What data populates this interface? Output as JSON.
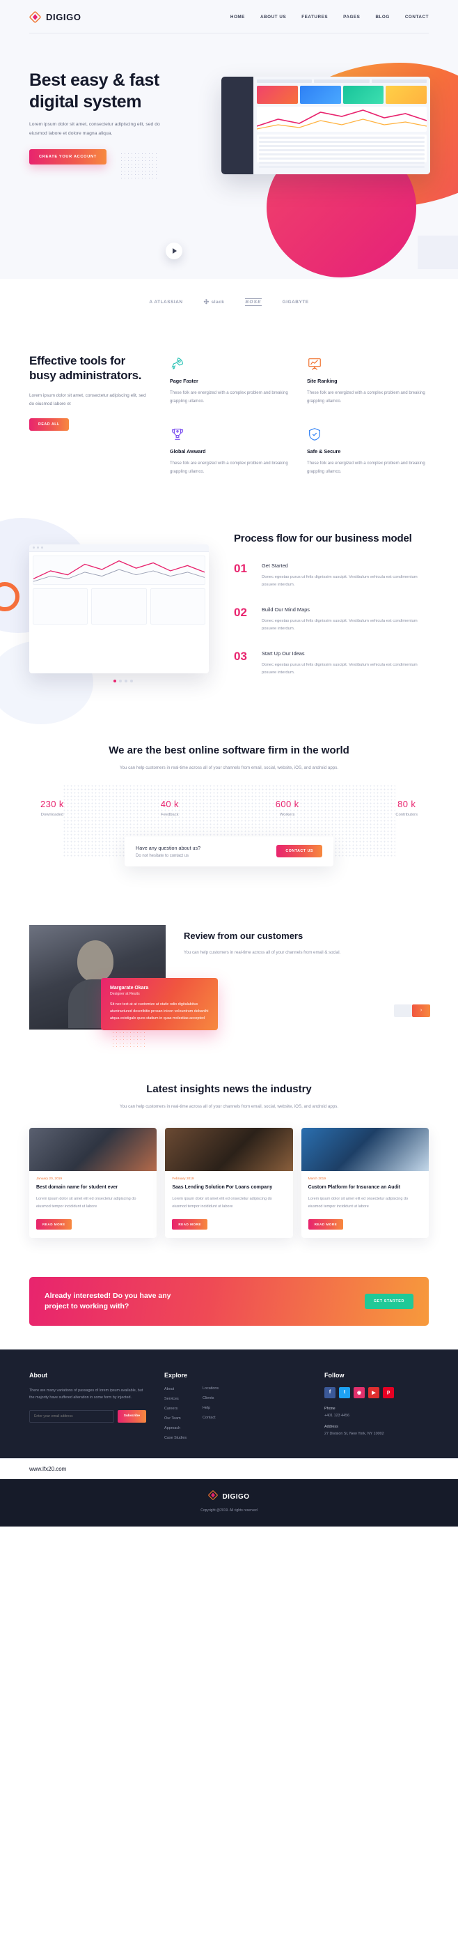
{
  "header": {
    "brand": "DIGIGO",
    "logo_icon": "diamond-logo-icon",
    "nav": [
      {
        "label": "HOME"
      },
      {
        "label": "ABOUT US"
      },
      {
        "label": "FEATURES"
      },
      {
        "label": "PAGES"
      },
      {
        "label": "BLOG"
      },
      {
        "label": "CONTACT"
      }
    ]
  },
  "hero": {
    "title": "Best easy & fast digital system",
    "subtitle": "Lorem ipsum dolor sit amet, consectetur adipiscing elit, sed do eiusmod labore et dolore magna aliqua.",
    "cta_label": "CREATE YOUR ACCOUNT",
    "play_icon": "play-icon"
  },
  "logos": [
    {
      "name": "A ATLASSIAN"
    },
    {
      "name": "slack"
    },
    {
      "name": "BOSE"
    },
    {
      "name": "GIGABYTE"
    }
  ],
  "features": {
    "title": "Effective tools for busy administrators.",
    "text": "Lorem ipsum dolor sit amet, consectetur adipiscing elit, sed do eiusmod labore et",
    "cta_label": "READ ALL",
    "cards": [
      {
        "icon": "rocket-icon",
        "title": "Page Faster",
        "text": "These folk are energized  with a complex problem and breaking grappling ullamco."
      },
      {
        "icon": "chart-board-icon",
        "title": "Site Ranking",
        "text": "These folk are energized  with a complex problem and breaking grappling ullamco."
      },
      {
        "icon": "trophy-icon",
        "title": "Global Awward",
        "text": "These folk are energized  with a complex problem and breaking grappling ullamco."
      },
      {
        "icon": "shield-check-icon",
        "title": "Safe & Secure",
        "text": "These folk are energized  with a complex problem and breaking grappling ullamco."
      }
    ]
  },
  "process": {
    "title": "Process flow for our business model",
    "steps": [
      {
        "num": "01",
        "title": "Get Started",
        "text": "Donec egestas purus ut felis dignissim suscipit. Vestibulum vehicula est condimentum posuere interdum."
      },
      {
        "num": "02",
        "title": "Build Our Mind Maps",
        "text": "Donec egestas purus ut felis dignissim suscipit. Vestibulum vehicula est condimentum posuere interdum."
      },
      {
        "num": "03",
        "title": "Start Up Our Ideas",
        "text": "Donec egestas purus ut felis dignissim suscipit. Vestibulum vehicula est condimentum posuere interdum."
      }
    ]
  },
  "stats": {
    "title": "We are the best online software firm in the world",
    "subtitle": "You can help customers in real-time across all of your channels from email, social, website, iOS, and android apps.",
    "items": [
      {
        "value": "230 k",
        "label": "Downloaded"
      },
      {
        "value": "40 k",
        "label": "Feedback"
      },
      {
        "value": "600 k",
        "label": "Workers"
      },
      {
        "value": "80 k",
        "label": "Contributors"
      }
    ],
    "cta_question": "Have any question about us?",
    "cta_sub": "Do not hesitate to contact us",
    "cta_label": "CONTACT US"
  },
  "review": {
    "title": "Review from our customers",
    "text": "You can help customers in real-time across all of your channels from email & social.",
    "quote": {
      "name": "Margarate Okara",
      "role": "Designer at Reuits",
      "text": "Sit nec text at at customize at static odio digitalabitus atuntractured describitio prosan inicon volountrum debanthi atqua existigalo quos statium in quas molestias accepted"
    },
    "prev_icon": "chevron-left-icon",
    "next_icon": "chevron-right-icon"
  },
  "blog": {
    "title": "Latest insights news the industry",
    "subtitle": "You can help customers in real-time across all of your channels from email, social, website, iOS, and android apps.",
    "read_more_label": "READ MORE",
    "posts": [
      {
        "date": "January 20, 2019",
        "title": "Best domain name for student ever",
        "text": "Lorem ipsum dolor sit amet elit ed onsectetur adipiscing  do eiusmod tempor incididunt ut labore"
      },
      {
        "date": "February 2019",
        "title": "Saas Lending Solution For Loans company",
        "text": "Lorem ipsum dolor sit amet elit ed onsectetur adipiscing  do eiusmod tempor incididunt ut labore"
      },
      {
        "date": "March 2019",
        "title": "Custom Platform for Insurance an Audit",
        "text": "Lorem ipsum dolor sit amet elit ed onsectetur adipiscing  do eiusmod tempor incididunt ut labore"
      }
    ]
  },
  "banner": {
    "title": "Already interested! Do you have any project to working with?",
    "cta_label": "GET STARTED"
  },
  "footer": {
    "about": {
      "title": "About",
      "text": "There are many variations of passages of lorem ipsum available, but the majority have suffered alteration in some form by injected.",
      "email_placeholder": "Enter your email address",
      "subscribe_label": "Subscribe"
    },
    "explore": {
      "title": "Explore",
      "col1": [
        "About",
        "Services",
        "Careers",
        "Our Team",
        "Approach",
        "Case Studies"
      ],
      "col2": [
        "Locations",
        "Clients",
        "Help",
        "Contact"
      ]
    },
    "follow": {
      "title": "Follow",
      "socials": [
        "facebook-icon",
        "twitter-icon",
        "instagram-icon",
        "youtube-icon",
        "pinterest-icon"
      ],
      "phone_label": "Phone",
      "phone_value": "+401 123 4456",
      "address_label": "Address",
      "address_value": "27 Division St, New York, NY 10002"
    }
  },
  "urlbar": {
    "url": "www.lfx20.com"
  },
  "copyright": {
    "brand": "DIGIGO",
    "text": "Copyright @2019. All rights reserved"
  }
}
